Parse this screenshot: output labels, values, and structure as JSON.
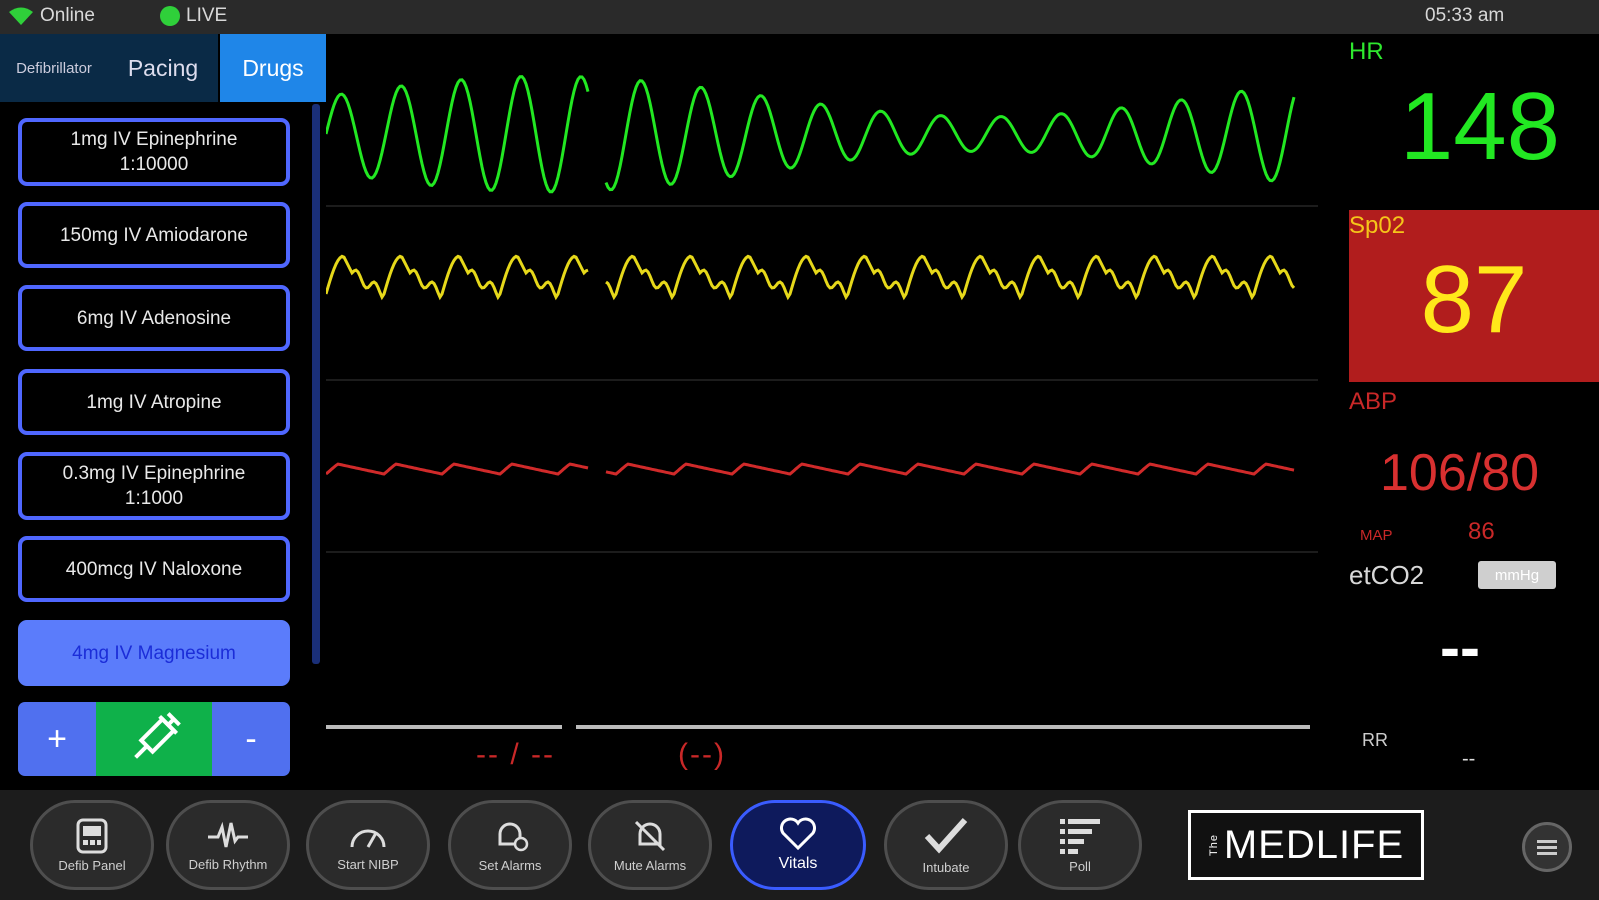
{
  "status": {
    "connection": "Online",
    "live": "LIVE",
    "time": "05:33 am"
  },
  "tabs": {
    "defibrillator": "Defibrillator",
    "pacing": "Pacing",
    "drugs": "Drugs"
  },
  "drugs": [
    {
      "label": "1mg IV Epinephrine\n1:10000"
    },
    {
      "label": "150mg IV Amiodarone"
    },
    {
      "label": "6mg IV Adenosine"
    },
    {
      "label": "1mg IV Atropine"
    },
    {
      "label": "0.3mg IV Epinephrine\n1:1000"
    },
    {
      "label": "400mcg IV Naloxone"
    },
    {
      "label": "4mg IV Magnesium",
      "selected": true
    }
  ],
  "dose": {
    "plus": "+",
    "minus": "-"
  },
  "nibp": {
    "readout": "-- / --",
    "map": "(--)"
  },
  "vitals": {
    "hr": {
      "label": "HR",
      "value": "148"
    },
    "spo2": {
      "label": "Sp02",
      "value": "87"
    },
    "abp": {
      "label": "ABP",
      "value": "106/80",
      "map_label": "MAP",
      "map_value": "86"
    },
    "etco2": {
      "label": "etCO2",
      "unit": "mmHg",
      "value": "--"
    },
    "rr": {
      "label": "RR",
      "value": "--"
    }
  },
  "toolbar": [
    {
      "label": "Defib Panel",
      "icon": "defib-panel-icon"
    },
    {
      "label": "Defib Rhythm",
      "icon": "rhythm-icon"
    },
    {
      "label": "Start NIBP",
      "icon": "gauge-icon"
    },
    {
      "label": "Set Alarms",
      "icon": "alarm-settings-icon"
    },
    {
      "label": "Mute Alarms",
      "icon": "mute-bell-icon"
    },
    {
      "label": "Vitals",
      "icon": "heart-icon",
      "active": true
    },
    {
      "label": "Intubate",
      "icon": "check-icon"
    },
    {
      "label": "Poll",
      "icon": "poll-icon"
    }
  ],
  "brand": {
    "prefix": "The",
    "name": "MEDLIFE"
  },
  "colors": {
    "hr": "#22e822",
    "spo2_wave": "#e6d81a",
    "abp": "#d02a2a",
    "spo2_alarm_bg": "#b11d1d",
    "drugs_tab": "#1f86e8",
    "drug_border": "#4f67ff"
  }
}
